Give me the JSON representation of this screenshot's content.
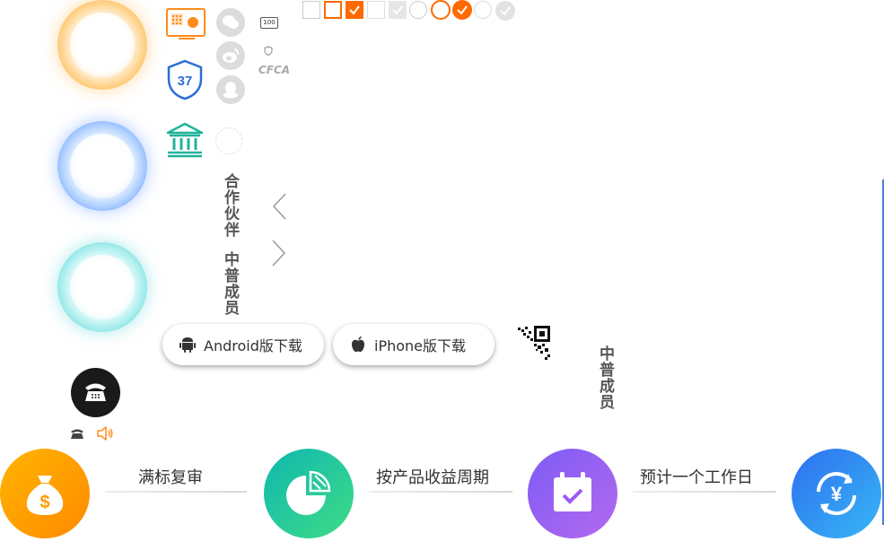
{
  "partners": {
    "line1": "合作伙伴",
    "line2": "中普成员"
  },
  "badges": {
    "small_label": "100",
    "cfca": "CFCA"
  },
  "icons": {
    "safe": "safe-icon",
    "shield": "shield-icon",
    "bank": "bank-icon",
    "wechat": "wechat-icon",
    "weibo": "weibo-icon",
    "qq": "qq-icon",
    "phone": "phone-icon",
    "speaker": "speaker-icon"
  },
  "shield_number": "37",
  "downloads": [
    {
      "label": "Android版下载",
      "icon": "android-icon"
    },
    {
      "label": "iPhone版下载",
      "icon": "apple-icon"
    }
  ],
  "member_vertical": "中普成员",
  "steps": [
    {
      "label": "满标复审",
      "icon": "money-bag-icon",
      "color": "#ff9c00"
    },
    {
      "label": "按产品收益周期",
      "icon": "pie-chart-icon",
      "color": "#1fc7a8"
    },
    {
      "label": "预计一个工作日",
      "icon": "calendar-check-icon",
      "color": "#9d5cf0"
    },
    {
      "label": "",
      "icon": "yuan-refresh-icon",
      "color": "#3a8ef5"
    }
  ],
  "colors": {
    "accent": "#ff6a00",
    "teal": "#1fb39a",
    "blue": "#2c6fd6"
  }
}
